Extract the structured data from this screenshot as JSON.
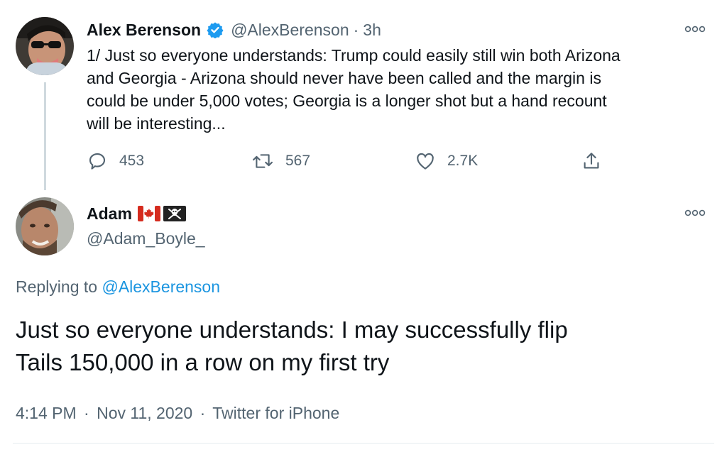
{
  "parent_tweet": {
    "author_name": "Alex Berenson",
    "handle": "@AlexBerenson",
    "separator": "·",
    "time": "3h",
    "text_lines": [
      "1/ Just so everyone understands: Trump could easily still win both Arizona",
      "and Georgia - Arizona should never have been called and the margin is",
      "could be under 5,000 votes; Georgia is a longer shot but a hand recount",
      "will be interesting..."
    ],
    "replies_count": "453",
    "retweets_count": "567",
    "likes_count": "2.7K"
  },
  "reply_tweet": {
    "author_name": "Adam",
    "handle": "@Adam_Boyle_",
    "replying_prefix": "Replying to",
    "replying_handle": "@AlexBerenson",
    "text_lines": [
      "Just so everyone understands: I may successfully flip",
      "Tails 150,000 in a row on my first try"
    ],
    "time": "4:14 PM",
    "date": "Nov 11, 2020",
    "source": "Twitter for iPhone",
    "separator": "·"
  },
  "colors": {
    "verified": "#1d9bf0",
    "link": "#1b95e0",
    "muted": "#536471",
    "text": "#0f1419"
  },
  "icons": [
    "verified-badge-icon",
    "more-icon",
    "reply-icon",
    "retweet-icon",
    "like-icon",
    "share-icon",
    "canada-flag-icon",
    "skull-crossbones-icon"
  ]
}
